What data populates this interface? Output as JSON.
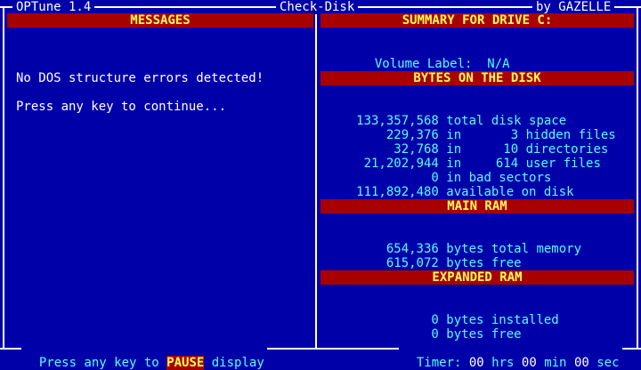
{
  "title_bar": {
    "app_name": "OPTune 1.4",
    "function_name": "Check-Disk",
    "author": "by GAZELLE"
  },
  "messages_panel": {
    "header": "MESSAGES",
    "line1": "No DOS structure errors detected!",
    "line2": "Press any key to continue..."
  },
  "summary_panel": {
    "header": "SUMMARY FOR DRIVE C:",
    "volume_label_caption": "Volume Label:",
    "volume_label_value": "N/A",
    "bytes_header": "BYTES ON THE DISK",
    "bytes_rows": [
      {
        "value": "133,357,568",
        "in": "",
        "count": "",
        "desc": "total disk space"
      },
      {
        "value": "229,376",
        "in": "in",
        "count": "3",
        "desc": "hidden files"
      },
      {
        "value": "32,768",
        "in": "in",
        "count": "10",
        "desc": "directories"
      },
      {
        "value": "21,202,944",
        "in": "in",
        "count": "614",
        "desc": "user files"
      },
      {
        "value": "0",
        "in": "",
        "count": "",
        "desc": "in bad sectors"
      },
      {
        "value": "111,892,480",
        "in": "",
        "count": "",
        "desc": "available on disk"
      }
    ],
    "main_ram_header": "MAIN RAM",
    "main_ram_rows": [
      {
        "value": "654,336",
        "desc": "bytes total memory"
      },
      {
        "value": "615,072",
        "desc": "bytes free"
      }
    ],
    "expanded_ram_header": "EXPANDED RAM",
    "expanded_ram_rows": [
      {
        "value": "0",
        "desc": "bytes installed"
      },
      {
        "value": "0",
        "desc": "bytes free"
      }
    ]
  },
  "status_bar": {
    "left_prefix": "Press any key to",
    "pause_key": "PAUSE",
    "left_suffix": "display",
    "timer_caption": "Timer:",
    "hrs_value": "00",
    "hrs_label": "hrs",
    "min_value": "00",
    "min_label": "min",
    "sec_value": "00",
    "sec_label": "sec"
  },
  "colors": {
    "background": "#0000a8",
    "header_bar": "#a80000",
    "header_text": "#ffff55",
    "body_text": "#55ffff",
    "frame": "#ffffff"
  }
}
